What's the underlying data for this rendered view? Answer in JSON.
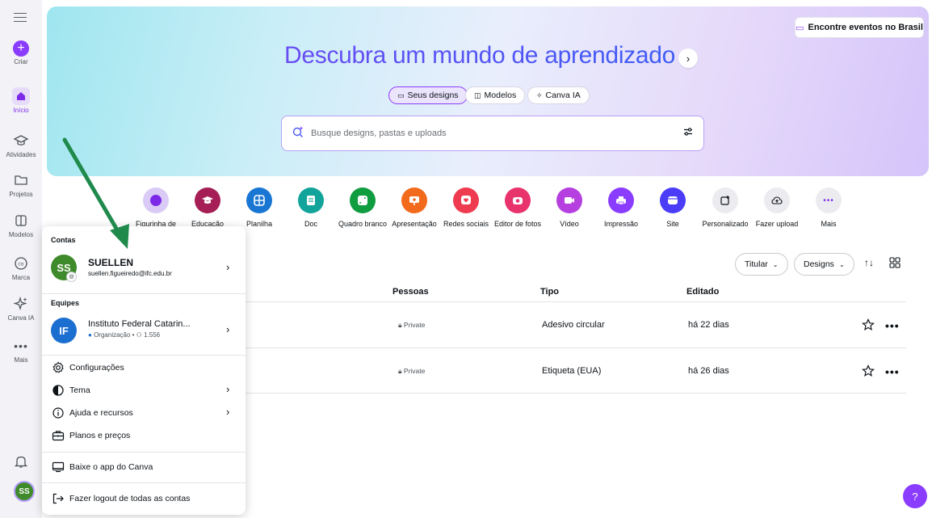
{
  "rail": {
    "items": [
      {
        "label": "Criar",
        "icon": "plus-icon"
      },
      {
        "label": "Início",
        "icon": "home-icon"
      },
      {
        "label": "Atividades",
        "icon": "graduation-cap-icon"
      },
      {
        "label": "Projetos",
        "icon": "folder-icon"
      },
      {
        "label": "Modelos",
        "icon": "template-icon"
      },
      {
        "label": "Marca",
        "icon": "brand-icon"
      },
      {
        "label": "Canva IA",
        "icon": "sparkles-icon"
      },
      {
        "label": "Mais",
        "icon": "more-dots-icon"
      }
    ],
    "avatar_initials": "SS"
  },
  "hero": {
    "events_button": "Encontre eventos no Brasil",
    "title": "Descubra um mundo de aprendizado",
    "tabs": [
      "Seus designs",
      "Modelos",
      "Canva IA"
    ],
    "search_placeholder": "Busque designs, pastas e uploads"
  },
  "shortcuts": [
    {
      "label": "Figurinha de",
      "color": "#d9cbf6",
      "icon": "sticker-icon"
    },
    {
      "label": "Educação",
      "color": "#a51e55",
      "icon": "education-icon"
    },
    {
      "label": "Planilha",
      "color": "#1976d2",
      "icon": "spreadsheet-icon"
    },
    {
      "label": "Doc",
      "color": "#12a39b",
      "icon": "doc-icon"
    },
    {
      "label": "Quadro branco",
      "color": "#0f9d40",
      "icon": "whiteboard-icon"
    },
    {
      "label": "Apresentação",
      "color": "#f26a1b",
      "icon": "presentation-icon"
    },
    {
      "label": "Redes sociais",
      "color": "#ef3b4f",
      "icon": "social-icon"
    },
    {
      "label": "Editor de fotos",
      "color": "#e8336d",
      "icon": "camera-icon"
    },
    {
      "label": "Vídeo",
      "color": "#b63fe0",
      "icon": "video-icon"
    },
    {
      "label": "Impressão",
      "color": "#8b3dff",
      "icon": "print-icon"
    },
    {
      "label": "Site",
      "color": "#4a3cf7",
      "icon": "site-icon"
    },
    {
      "label": "Personalizado",
      "color": "#ececf0",
      "icon": "custom-size-icon"
    },
    {
      "label": "Fazer upload",
      "color": "#ececf0",
      "icon": "upload-icon"
    },
    {
      "label": "Mais",
      "color": "#ececf0",
      "icon": "more-dots-icon"
    }
  ],
  "list_controls": {
    "owner_dropdown": "Titular",
    "type_dropdown": "Designs"
  },
  "table": {
    "headers": [
      "Pessoas",
      "Tipo",
      "Editado"
    ],
    "rows": [
      {
        "access": "Private",
        "type": "Adesivo circular",
        "edited": "há 22 dias"
      },
      {
        "access": "Private",
        "type": "Etiqueta (EUA)",
        "edited": "há 26 dias"
      }
    ]
  },
  "account_menu": {
    "section_accounts": "Contas",
    "account": {
      "name": "SUELLEN",
      "email": "suellen.figueiredo@ifc.edu.br",
      "initials": "SS",
      "color": "#3f8a2a"
    },
    "section_teams": "Equipes",
    "team": {
      "name": "Instituto Federal Catarin...",
      "meta": "Organização • ⚇ 1.556",
      "initials": "IF",
      "color": "#1b6fd1"
    },
    "items": [
      {
        "label": "Configurações",
        "icon": "gear-icon"
      },
      {
        "label": "Tema",
        "icon": "theme-icon"
      },
      {
        "label": "Ajuda e recursos",
        "icon": "info-icon"
      },
      {
        "label": "Planos e preços",
        "icon": "briefcase-icon"
      },
      {
        "label": "Baixe o app do Canva",
        "icon": "desktop-icon"
      },
      {
        "label": "Fazer logout de todas as contas",
        "icon": "logout-icon"
      }
    ]
  },
  "help_label": "?",
  "colors": {
    "accent": "#8b3dff",
    "annotation_arrow": "#1f8a4c"
  }
}
